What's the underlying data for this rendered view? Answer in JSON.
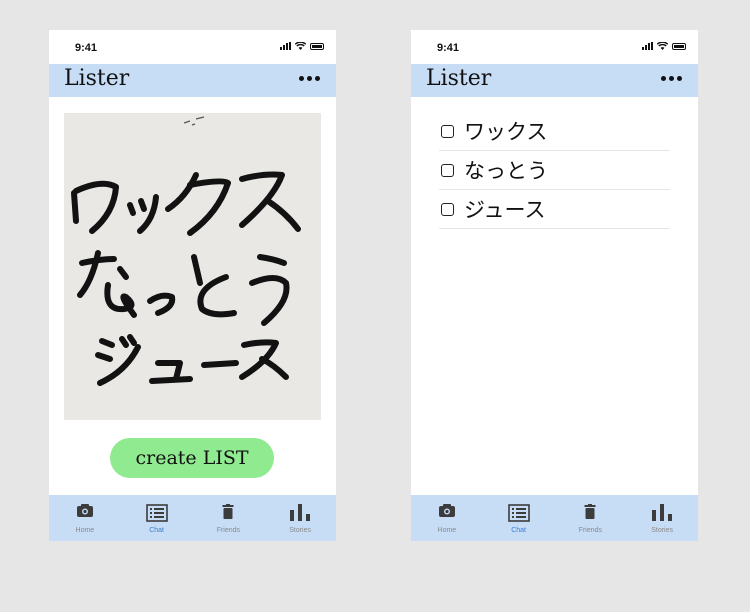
{
  "status": {
    "time": "9:41"
  },
  "app": {
    "title": "Lister"
  },
  "screen_capture": {
    "handwritten_lines": [
      "ワックス",
      "なっとう",
      "ジュース"
    ],
    "create_button_label": "create LIST"
  },
  "screen_list": {
    "items": [
      {
        "label": "ワックス",
        "checked": false
      },
      {
        "label": "なっとう",
        "checked": false
      },
      {
        "label": "ジュース",
        "checked": false
      }
    ]
  },
  "tabs": [
    {
      "label": "Home",
      "icon": "camera-icon",
      "active": false
    },
    {
      "label": "Chat",
      "icon": "list-icon",
      "active": true
    },
    {
      "label": "Friends",
      "icon": "trash-icon",
      "active": false
    },
    {
      "label": "Stories",
      "icon": "bar-chart-icon",
      "active": false
    }
  ],
  "colors": {
    "header_bg": "#c7dcf5",
    "button_bg": "#90ea90",
    "active_tab": "#3a7fd5"
  }
}
